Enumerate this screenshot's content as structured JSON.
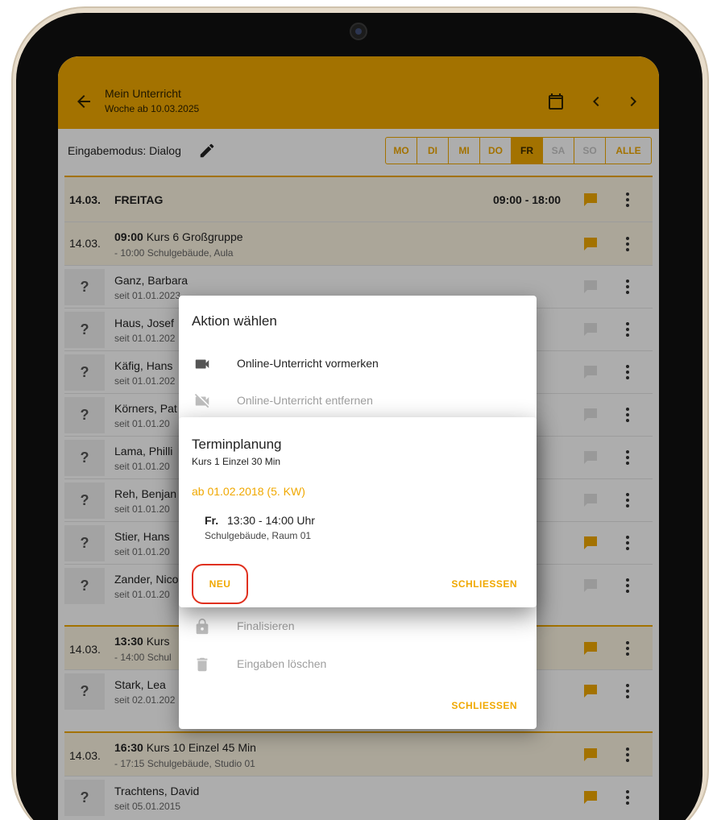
{
  "appbar": {
    "title": "Mein Unterricht",
    "subtitle": "Woche ab 10.03.2025",
    "color": "#f0a800"
  },
  "toolbar": {
    "mode_label": "Eingabemodus: Dialog",
    "days": [
      "MO",
      "DI",
      "MI",
      "DO",
      "FR",
      "SA",
      "SO",
      "ALLE"
    ],
    "active_day": "FR"
  },
  "day_header": {
    "date": "14.03.",
    "weekday": "FREITAG",
    "time_range": "09:00 - 18:00"
  },
  "course1": {
    "date": "14.03.",
    "time": "09:00",
    "name": "Kurs 6 Großgruppe",
    "detail": "- 10:00 Schulgebäude, Aula"
  },
  "students1": [
    {
      "q": "?",
      "name": "Ganz, Barbara",
      "since": "seit 01.01.2023"
    },
    {
      "q": "?",
      "name": "Haus, Josef",
      "since": "seit 01.01.202"
    },
    {
      "q": "?",
      "name": "Käfig, Hans",
      "since": "seit 01.01.202"
    },
    {
      "q": "?",
      "name": "Körners, Pat",
      "since": "seit 01.01.20"
    },
    {
      "q": "?",
      "name": "Lama, Philli",
      "since": "seit 01.01.20"
    },
    {
      "q": "?",
      "name": "Reh, Benjan",
      "since": "seit 01.01.20"
    },
    {
      "q": "?",
      "name": "Stier, Hans",
      "since": "seit 01.01.20"
    },
    {
      "q": "?",
      "name": "Zander, Nico",
      "since": "seit 01.01.20"
    }
  ],
  "course2": {
    "date": "14.03.",
    "time": "13:30",
    "name": "Kurs",
    "detail": "- 14:00 Schul"
  },
  "students2": [
    {
      "q": "?",
      "name": "Stark, Lea",
      "since": "seit 02.01.202"
    }
  ],
  "course3": {
    "date": "14.03.",
    "time": "16:30",
    "name": "Kurs 10 Einzel 45 Min",
    "detail": "- 17:15 Schulgebäude, Studio 01"
  },
  "students3": [
    {
      "q": "?",
      "name": "Trachtens, David",
      "since": "seit 05.01.2015"
    }
  ],
  "action_dialog": {
    "title": "Aktion wählen",
    "items": [
      {
        "label": "Online-Unterricht vormerken",
        "icon": "video-camera-icon",
        "enabled": true
      },
      {
        "label": "Online-Unterricht entfernen",
        "icon": "video-off-icon",
        "enabled": false
      },
      {
        "label": "Finalisieren",
        "icon": "lock-icon",
        "enabled": false
      },
      {
        "label": "Eingaben löschen",
        "icon": "trash-icon",
        "enabled": false
      }
    ],
    "close_label": "SCHLIESSEN"
  },
  "schedule_dialog": {
    "title": "Terminplanung",
    "subtitle": "Kurs 1 Einzel 30 Min",
    "from": "ab 01.02.2018 (5. KW)",
    "day": "Fr.",
    "time": "13:30 - 14:00 Uhr",
    "place": "Schulgebäude, Raum 01",
    "new_label": "NEU",
    "close_label": "SCHLIESSEN"
  }
}
